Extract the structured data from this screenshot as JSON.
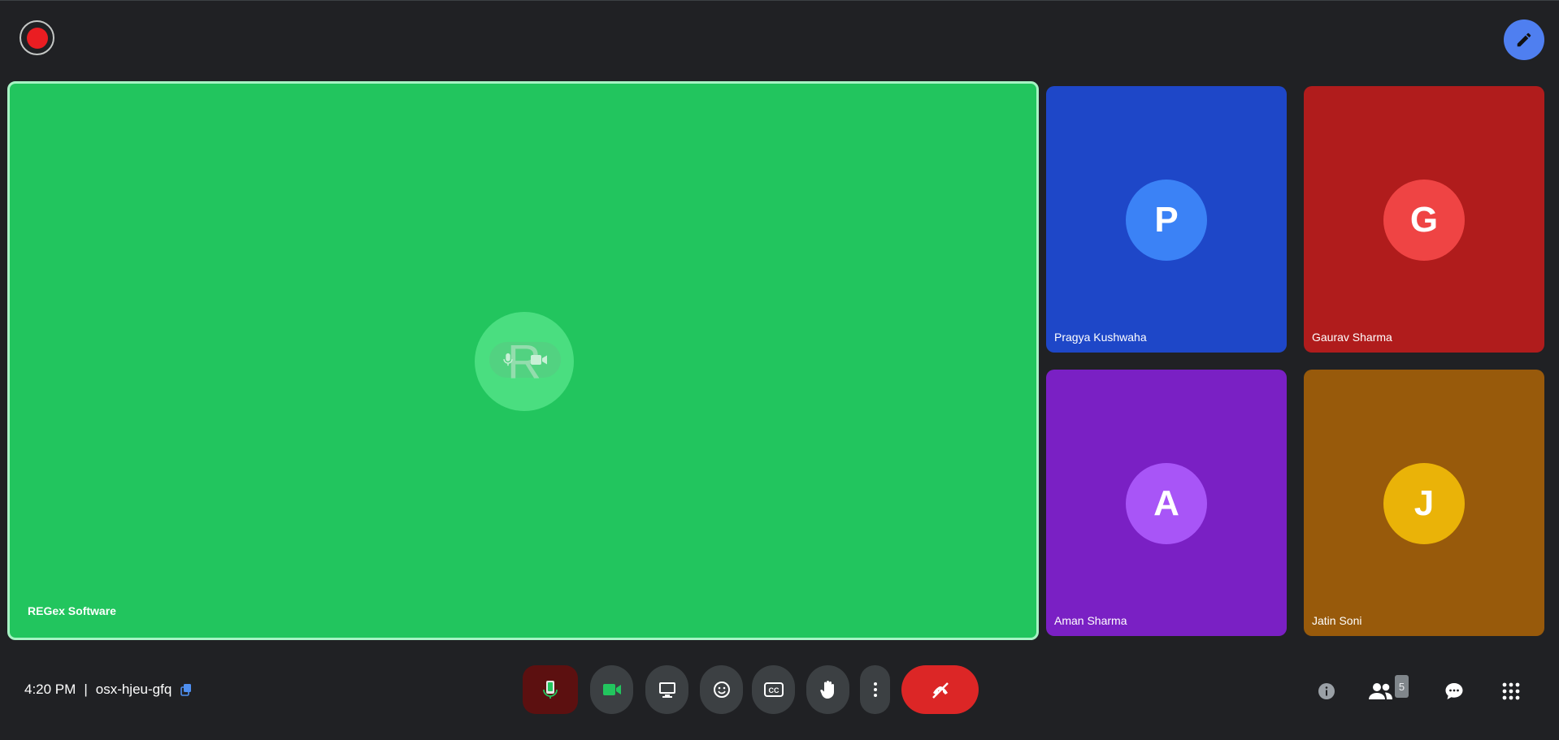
{
  "meeting": {
    "time": "4:20 PM",
    "separator": "|",
    "code": "osx-hjeu-gfq"
  },
  "main_participant": {
    "name": "REGex Software",
    "initial": "R",
    "tile_color": "#22c55e",
    "avatar_color": "#4ade80"
  },
  "participants": [
    {
      "name": "Pragya Kushwaha",
      "initial": "P",
      "tile_color": "#1e47c8",
      "avatar_color": "#3b82f6"
    },
    {
      "name": "Gaurav Sharma",
      "initial": "G",
      "tile_color": "#b01c1c",
      "avatar_color": "#ef4444"
    },
    {
      "name": "Aman Sharma",
      "initial": "A",
      "tile_color": "#7a20c4",
      "avatar_color": "#a855f7"
    },
    {
      "name": "Jatin Soni",
      "initial": "J",
      "tile_color": "#985a0b",
      "avatar_color": "#eab308"
    }
  ],
  "participant_count": "5",
  "controls": [
    "mic-icon",
    "camera-icon",
    "present-screen-icon",
    "emoji-icon",
    "captions-icon",
    "raise-hand-icon",
    "more-options-icon",
    "leave-call-icon"
  ],
  "side_controls": [
    "info-icon",
    "people-icon",
    "chat-icon",
    "activities-icon"
  ],
  "colors": {
    "background": "#202124",
    "control_bg": "#3c4043",
    "mic_bg": "#5c1010",
    "leave": "#dc2626",
    "accent": "#4f7ff0",
    "record": "#ea1d22"
  }
}
